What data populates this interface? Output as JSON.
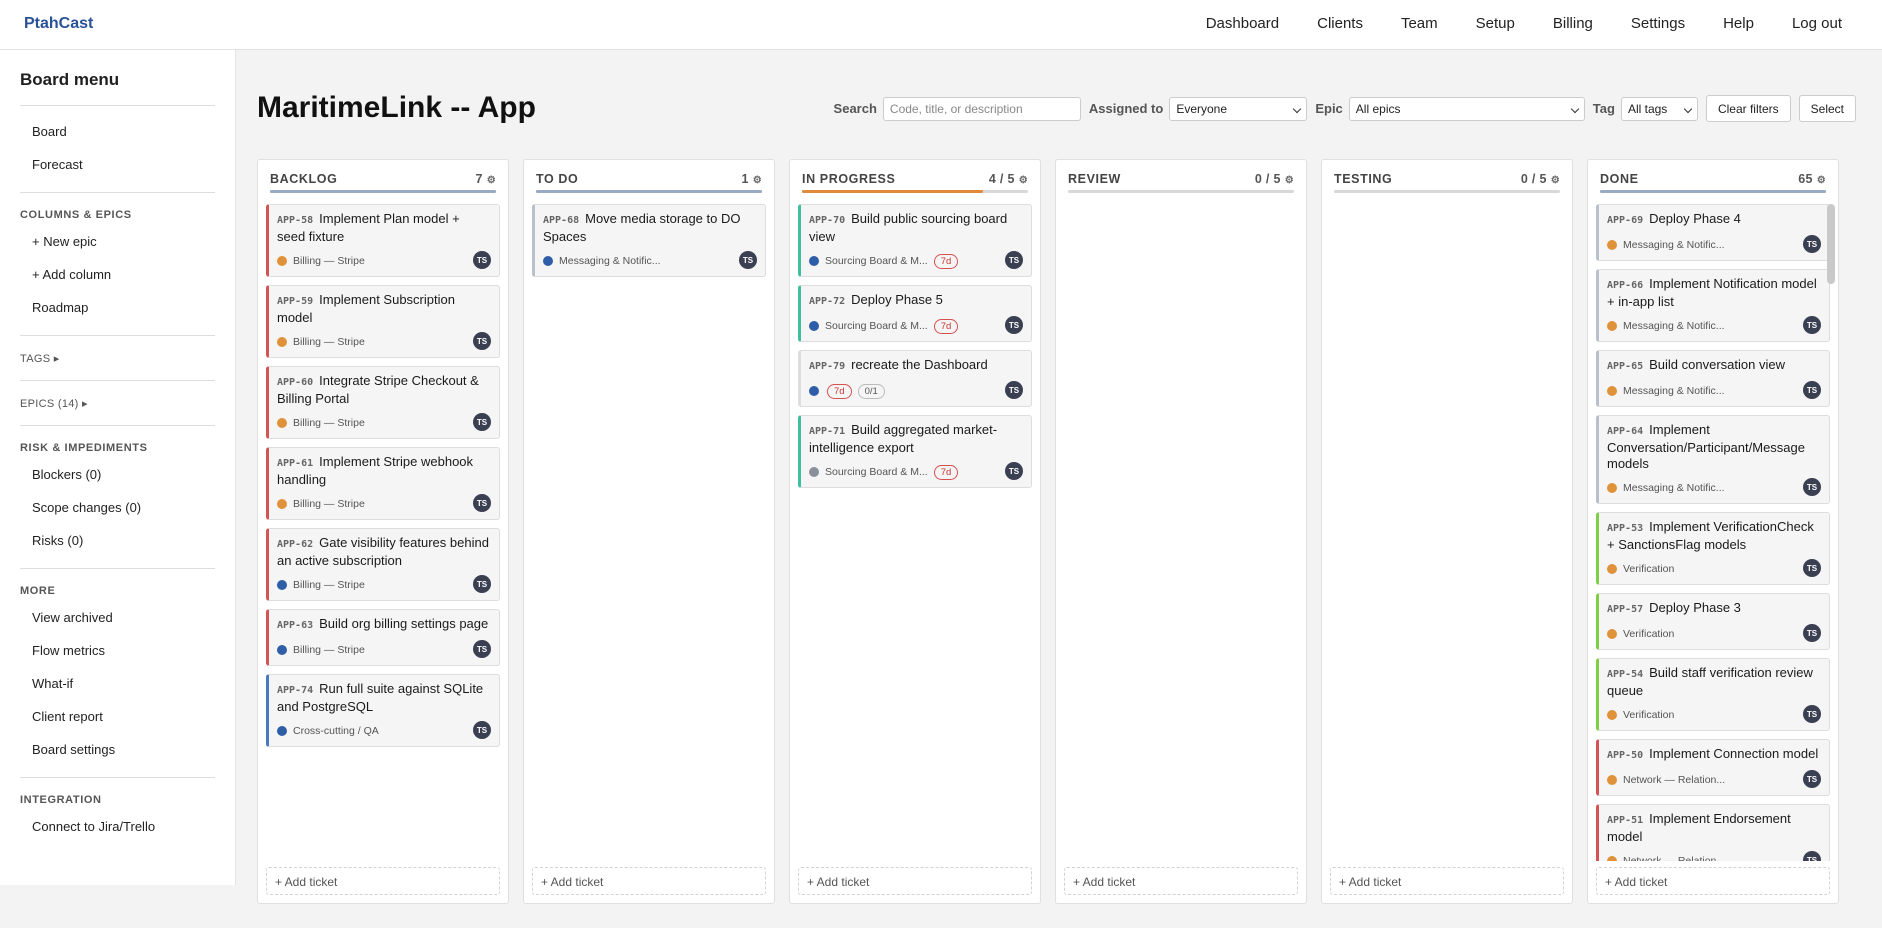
{
  "app": {
    "brand": "PtahCast"
  },
  "nav": [
    "Dashboard",
    "Clients",
    "Team",
    "Setup",
    "Billing",
    "Settings",
    "Help",
    "Log out"
  ],
  "sidebar": {
    "title": "Board menu",
    "top_items": [
      "Board",
      "Forecast"
    ],
    "sections": [
      {
        "heading": "COLUMNS & EPICS",
        "items": [
          "+ New epic",
          "+ Add column",
          "Roadmap"
        ]
      },
      {
        "heading": "TAGS ▸",
        "items": []
      },
      {
        "heading": "EPICS (14) ▸",
        "items": []
      },
      {
        "heading": "RISK & IMPEDIMENTS",
        "items": [
          "Blockers (0)",
          "Scope changes (0)",
          "Risks (0)"
        ]
      },
      {
        "heading": "MORE",
        "items": [
          "View archived",
          "Flow metrics",
          "What-if",
          "Client report",
          "Board settings"
        ]
      },
      {
        "heading": "INTEGRATION",
        "items": [
          "Connect to Jira/Trello"
        ]
      }
    ]
  },
  "page": {
    "title": "MaritimeLink -- App"
  },
  "filters": {
    "search_label": "Search",
    "search_placeholder": "Code, title, or description",
    "assigned_label": "Assigned to",
    "assigned_value": "Everyone",
    "epic_label": "Epic",
    "epic_value": "All epics",
    "tag_label": "Tag",
    "tag_value": "All tags",
    "clear_label": "Clear filters",
    "select_label": "Select"
  },
  "add_ticket_label": "+ Add ticket",
  "colors": {
    "red": "#d35454",
    "blue": "#4a78c2",
    "teal": "#3fbfa0",
    "green": "#7fce4a",
    "grey_border": "#b9c0cc",
    "orange_dot": "#e0923a",
    "blue_dot": "#2f5ea8",
    "grey_dot": "#8a8f99",
    "wip_orange": "#e0893a",
    "col_bar_blue": "#9aa9c4"
  },
  "columns": [
    {
      "name": "BACKLOG",
      "count": "7",
      "bar_color": "#9aa9c4",
      "bar_fill": 1,
      "cards": [
        {
          "code": "APP-58",
          "title": "Implement Plan model + seed fixture",
          "epic": "Billing — Stripe",
          "dot": "#e0923a",
          "border": "#d35454",
          "badges": []
        },
        {
          "code": "APP-59",
          "title": "Implement Subscription model",
          "epic": "Billing — Stripe",
          "dot": "#e0923a",
          "border": "#d35454",
          "badges": []
        },
        {
          "code": "APP-60",
          "title": "Integrate Stripe Checkout & Billing Portal",
          "epic": "Billing — Stripe",
          "dot": "#e0923a",
          "border": "#d35454",
          "badges": []
        },
        {
          "code": "APP-61",
          "title": "Implement Stripe webhook handling",
          "epic": "Billing — Stripe",
          "dot": "#e0923a",
          "border": "#d35454",
          "badges": []
        },
        {
          "code": "APP-62",
          "title": "Gate visibility features behind an active subscription",
          "epic": "Billing — Stripe",
          "dot": "#2f5ea8",
          "border": "#d35454",
          "badges": []
        },
        {
          "code": "APP-63",
          "title": "Build org billing settings page",
          "epic": "Billing — Stripe",
          "dot": "#2f5ea8",
          "border": "#d35454",
          "badges": []
        },
        {
          "code": "APP-74",
          "title": "Run full suite against SQLite and PostgreSQL",
          "epic": "Cross-cutting / QA",
          "dot": "#2f5ea8",
          "border": "#4a78c2",
          "badges": []
        }
      ]
    },
    {
      "name": "TO DO",
      "count": "1",
      "bar_color": "#9aa9c4",
      "bar_fill": 1,
      "cards": [
        {
          "code": "APP-68",
          "title": "Move media storage to DO Spaces",
          "epic": "Messaging & Notific...",
          "dot": "#2f5ea8",
          "border": "#b9c0cc",
          "badges": []
        }
      ]
    },
    {
      "name": "IN PROGRESS",
      "count": "4 / 5",
      "bar_color": "#e0893a",
      "bar_fill": 0.8,
      "cards": [
        {
          "code": "APP-70",
          "title": "Build public sourcing board view",
          "epic": "Sourcing Board & M...",
          "dot": "#2f5ea8",
          "border": "#3fbfa0",
          "badges": [
            {
              "t": "7d",
              "k": "red"
            }
          ]
        },
        {
          "code": "APP-72",
          "title": "Deploy Phase 5",
          "epic": "Sourcing Board & M...",
          "dot": "#2f5ea8",
          "border": "#3fbfa0",
          "badges": [
            {
              "t": "7d",
              "k": "red"
            }
          ]
        },
        {
          "code": "APP-79",
          "title": "recreate the Dashboard",
          "epic": "",
          "dot": "#2f5ea8",
          "border": "#dddddd",
          "badges": [
            {
              "t": "7d",
              "k": "red"
            },
            {
              "t": "0/1",
              "k": "grey"
            }
          ]
        },
        {
          "code": "APP-71",
          "title": "Build aggregated market-intelligence export",
          "epic": "Sourcing Board & M...",
          "dot": "#8a8f99",
          "border": "#3fbfa0",
          "badges": [
            {
              "t": "7d",
              "k": "red"
            }
          ]
        }
      ]
    },
    {
      "name": "REVIEW",
      "count": "0 / 5",
      "bar_color": "#d8d8d8",
      "bar_fill": 0,
      "cards": []
    },
    {
      "name": "TESTING",
      "count": "0 / 5",
      "bar_color": "#d8d8d8",
      "bar_fill": 0,
      "cards": []
    },
    {
      "name": "DONE",
      "count": "65",
      "bar_color": "#9aa9c4",
      "bar_fill": 1,
      "cards": [
        {
          "code": "APP-69",
          "title": "Deploy Phase 4",
          "epic": "Messaging & Notific...",
          "dot": "#e0923a",
          "border": "#b9c0cc",
          "badges": []
        },
        {
          "code": "APP-66",
          "title": "Implement Notification model + in-app list",
          "epic": "Messaging & Notific...",
          "dot": "#e0923a",
          "border": "#b9c0cc",
          "badges": []
        },
        {
          "code": "APP-65",
          "title": "Build conversation view",
          "epic": "Messaging & Notific...",
          "dot": "#e0923a",
          "border": "#b9c0cc",
          "badges": []
        },
        {
          "code": "APP-64",
          "title": "Implement Conversation/Participant/Message models",
          "epic": "Messaging & Notific...",
          "dot": "#e0923a",
          "border": "#b9c0cc",
          "badges": []
        },
        {
          "code": "APP-53",
          "title": "Implement VerificationCheck + SanctionsFlag models",
          "epic": "Verification",
          "dot": "#e0923a",
          "border": "#7fce4a",
          "badges": []
        },
        {
          "code": "APP-57",
          "title": "Deploy Phase 3",
          "epic": "Verification",
          "dot": "#e0923a",
          "border": "#7fce4a",
          "badges": []
        },
        {
          "code": "APP-54",
          "title": "Build staff verification review queue",
          "epic": "Verification",
          "dot": "#e0923a",
          "border": "#7fce4a",
          "badges": []
        },
        {
          "code": "APP-50",
          "title": "Implement Connection model",
          "epic": "Network — Relation...",
          "dot": "#e0923a",
          "border": "#d35454",
          "badges": []
        },
        {
          "code": "APP-51",
          "title": "Implement Endorsement model",
          "epic": "Network — Relation...",
          "dot": "#e0923a",
          "border": "#d35454",
          "badges": []
        }
      ]
    }
  ],
  "avatar_initials": "TS"
}
